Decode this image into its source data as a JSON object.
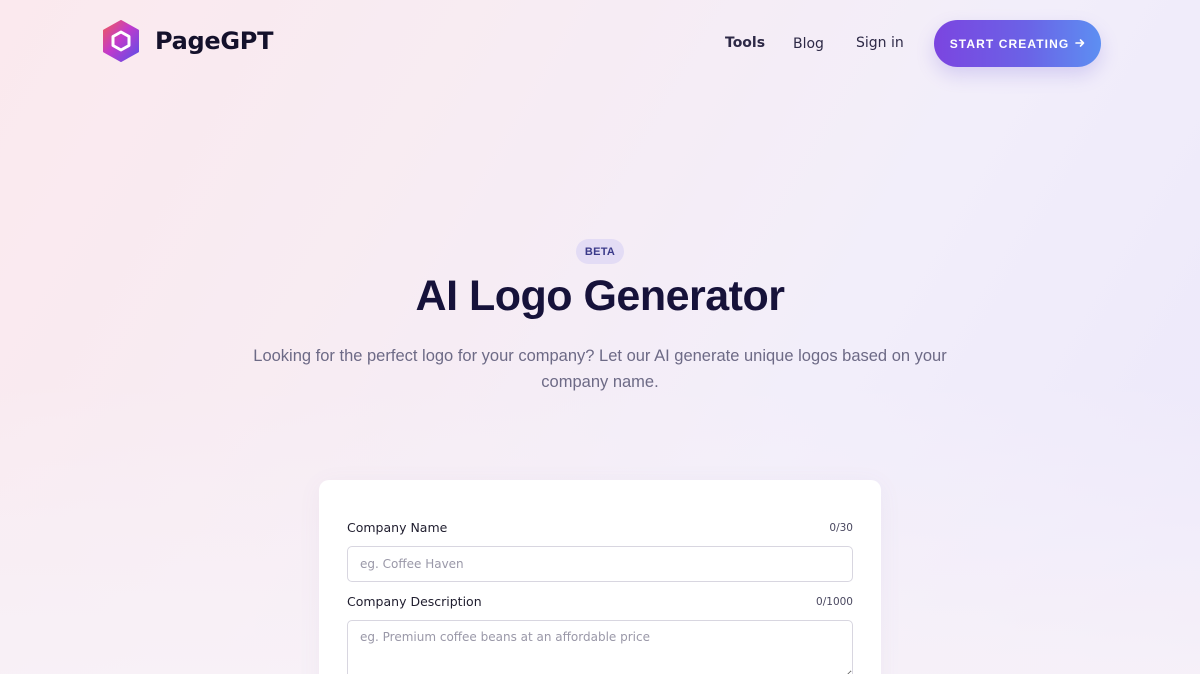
{
  "header": {
    "brand": "PageGPT",
    "nav": {
      "tools": "Tools",
      "blog": "Blog",
      "sign_in": "Sign in"
    },
    "cta_label": "START CREATING",
    "cta_icon": "arrow-right-icon"
  },
  "hero": {
    "badge": "BETA",
    "title": "AI Logo Generator",
    "subtitle": "Looking for the perfect logo for your company? Let our AI generate unique logos based on your company name."
  },
  "form": {
    "company_name": {
      "label": "Company Name",
      "counter": "0/30",
      "value": "",
      "placeholder": "eg. Coffee Haven"
    },
    "company_description": {
      "label": "Company Description",
      "counter": "0/1000",
      "value": "",
      "placeholder": "eg. Premium coffee beans at an affordable price"
    }
  },
  "colors": {
    "accent_start": "#7b45e0",
    "accent_end": "#5d8ff2",
    "title": "#16123a",
    "badge_bg": "#e3dcf5"
  }
}
